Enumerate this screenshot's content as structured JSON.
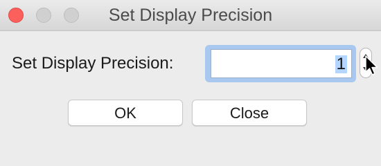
{
  "window": {
    "title": "Set Display Precision"
  },
  "form": {
    "label": "Set Display Precision:",
    "value": "1"
  },
  "buttons": {
    "ok": "OK",
    "close": "Close"
  },
  "colors": {
    "close_button": "#fc605c",
    "focus_ring": "#a9c8ef",
    "selection": "#b4d5fe"
  },
  "icons": {
    "stepper": "stepper-arrows",
    "cursor": "arrow-pointer"
  }
}
